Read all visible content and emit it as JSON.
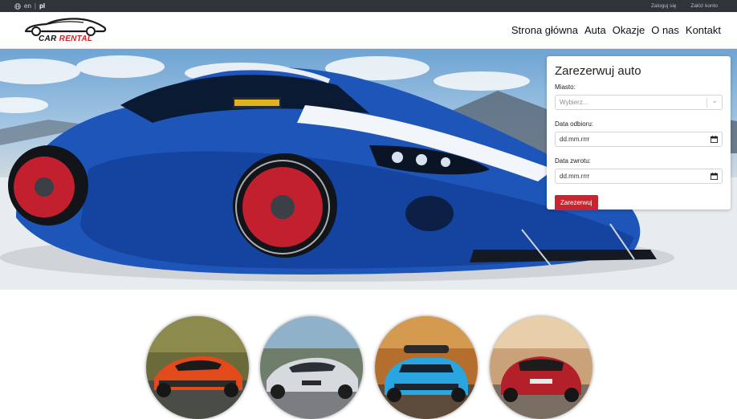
{
  "topbar": {
    "languages": [
      "en",
      "pl"
    ],
    "selected_language": "pl",
    "separator": "|",
    "login_label": "Zaloguj się",
    "register_label": "Załóż konto"
  },
  "brand": {
    "word1": "CAR",
    "word2": "RENTAL",
    "accent_color": "#d6202a"
  },
  "nav": {
    "items": [
      {
        "label": "Strona główna"
      },
      {
        "label": "Auta"
      },
      {
        "label": "Okazje"
      },
      {
        "label": "O nas"
      },
      {
        "label": "Kontakt"
      }
    ]
  },
  "booking": {
    "title": "Zarezerwuj auto",
    "city_label": "Miasto:",
    "city_placeholder": "Wybierz...",
    "pickup_label": "Data odbioru:",
    "pickup_value": "dd.mm.rrrr",
    "return_label": "Data zwrotu:",
    "return_value": "dd.mm.rrrr",
    "submit_label": "Zarezerwuj",
    "button_color": "#c9242f"
  },
  "hero": {
    "image": "blue-sports-car-photo"
  },
  "gallery": {
    "items": [
      {
        "image": "orange-sports-car-photo"
      },
      {
        "image": "silver-sedan-photo"
      },
      {
        "image": "blue-suv-photo"
      },
      {
        "image": "red-hatchback-photo"
      }
    ]
  }
}
